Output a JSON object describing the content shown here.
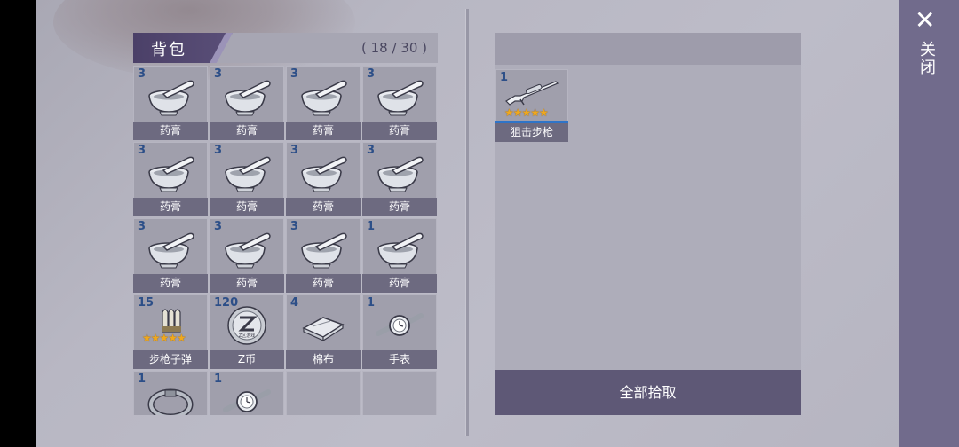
{
  "backpack": {
    "title": "背包",
    "count": "( 18 / 30 )",
    "slots": [
      {
        "qty": "3",
        "label": "药膏",
        "icon": "mortar-pestle-icon"
      },
      {
        "qty": "3",
        "label": "药膏",
        "icon": "mortar-pestle-icon"
      },
      {
        "qty": "3",
        "label": "药膏",
        "icon": "mortar-pestle-icon"
      },
      {
        "qty": "3",
        "label": "药膏",
        "icon": "mortar-pestle-icon"
      },
      {
        "qty": "3",
        "label": "药膏",
        "icon": "mortar-pestle-icon"
      },
      {
        "qty": "3",
        "label": "药膏",
        "icon": "mortar-pestle-icon"
      },
      {
        "qty": "3",
        "label": "药膏",
        "icon": "mortar-pestle-icon"
      },
      {
        "qty": "3",
        "label": "药膏",
        "icon": "mortar-pestle-icon"
      },
      {
        "qty": "3",
        "label": "药膏",
        "icon": "mortar-pestle-icon"
      },
      {
        "qty": "3",
        "label": "药膏",
        "icon": "mortar-pestle-icon"
      },
      {
        "qty": "3",
        "label": "药膏",
        "icon": "mortar-pestle-icon"
      },
      {
        "qty": "1",
        "label": "药膏",
        "icon": "mortar-pestle-icon"
      },
      {
        "qty": "15",
        "label": "步枪子弹",
        "icon": "rifle-bullets-icon",
        "stars": "★★★★★"
      },
      {
        "qty": "120",
        "label": "Z币",
        "icon": "z-coin-icon",
        "coin_text": "Z区游戏"
      },
      {
        "qty": "4",
        "label": "棉布",
        "icon": "cotton-cloth-icon"
      },
      {
        "qty": "1",
        "label": "手表",
        "icon": "wristwatch-icon"
      },
      {
        "qty": "1",
        "label": "",
        "icon": "bracelet-icon"
      },
      {
        "qty": "1",
        "label": "",
        "icon": "wristwatch-icon"
      },
      {
        "qty": "",
        "label": "",
        "icon": ""
      },
      {
        "qty": "",
        "label": "",
        "icon": ""
      }
    ]
  },
  "loot": {
    "items": [
      {
        "qty": "1",
        "label": "狙击步枪",
        "icon": "sniper-rifle-icon",
        "stars": "★★★★★"
      }
    ],
    "pickup_all_label": "全部拾取"
  },
  "close": {
    "icon": "close-icon",
    "label": "关闭"
  },
  "colors": {
    "panel_header": "#5a4f78",
    "label_bar": "#6d6a80",
    "qty_text": "#2d4f88",
    "star": "#f0a81c",
    "quality_bar": "#2f74c8",
    "close_bar": "#716b8c"
  }
}
